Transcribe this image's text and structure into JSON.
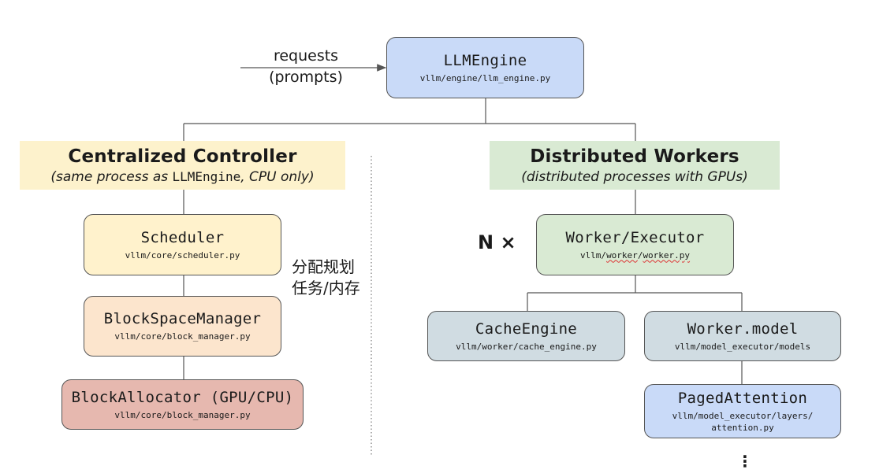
{
  "requests": {
    "line1": "requests",
    "line2": "(prompts)"
  },
  "llm_engine": {
    "title": "LLMEngine",
    "path": "vllm/engine/llm_engine.py"
  },
  "controller": {
    "title": "Centralized Controller",
    "sub_before": "(same process as ",
    "sub_mono": "LLMEngine",
    "sub_after": ", CPU only)",
    "bg": "#fdf2cc"
  },
  "workers_header": {
    "title": "Distributed Workers",
    "sub": "(distributed processes with GPUs)",
    "bg": "#d9ead3"
  },
  "scheduler": {
    "title": "Scheduler",
    "path": "vllm/core/scheduler.py",
    "bg": "#fff2cc"
  },
  "block_space_manager": {
    "title": "BlockSpaceManager",
    "path": "vllm/core/block_manager.py",
    "bg": "#fce5cd"
  },
  "block_allocator": {
    "title": "BlockAllocator (GPU/CPU)",
    "path": "vllm/core/block_manager.py",
    "bg": "#e6b8af"
  },
  "cjk_note": {
    "line1": "分配规划",
    "line2": "任务/内存"
  },
  "n_times": "N ×",
  "worker_executor": {
    "title": "Worker/Executor",
    "path_a": "vllm/",
    "path_b": "worker",
    "path_c": "/",
    "path_d": "worker.py",
    "bg": "#d9ead3"
  },
  "cache_engine": {
    "title": "CacheEngine",
    "path": "vllm/worker/cache_engine.py",
    "bg": "#d0dce2"
  },
  "worker_model": {
    "title": "Worker.model",
    "path": "vllm/model_executor/models",
    "bg": "#d0dce2"
  },
  "paged_attention": {
    "title": "PagedAttention",
    "path_line1": "vllm/model_executor/layers/",
    "path_line2": "attention.py",
    "bg": "#c9daf8"
  },
  "ellipsis": "⋮",
  "colors": {
    "engine_bg": "#c9daf8",
    "line": "#555555"
  }
}
